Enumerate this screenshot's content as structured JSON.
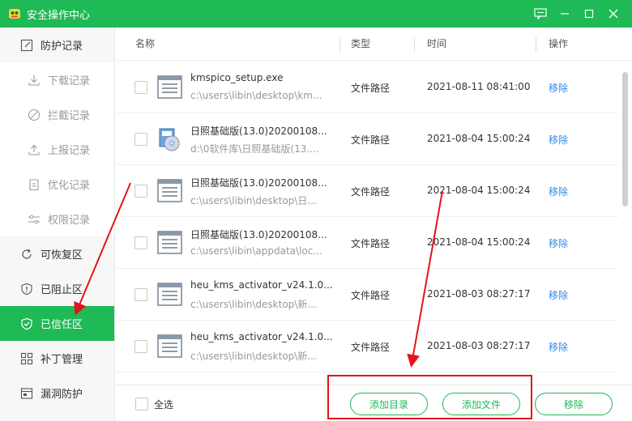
{
  "app": {
    "title": "安全操作中心"
  },
  "sidebar": {
    "items": [
      {
        "label": "防护记录",
        "icon": "edit-icon",
        "sub": false
      },
      {
        "label": "下载记录",
        "icon": "download-icon",
        "sub": true
      },
      {
        "label": "拦截记录",
        "icon": "block-icon",
        "sub": true
      },
      {
        "label": "上报记录",
        "icon": "upload-icon",
        "sub": true
      },
      {
        "label": "优化记录",
        "icon": "clipboard-icon",
        "sub": true
      },
      {
        "label": "权限记录",
        "icon": "sliders-icon",
        "sub": true
      },
      {
        "label": "可恢复区",
        "icon": "restore-icon",
        "sub": false
      },
      {
        "label": "已阻止区",
        "icon": "shield-alert-icon",
        "sub": false
      },
      {
        "label": "已信任区",
        "icon": "shield-check-icon",
        "sub": false,
        "active": true
      },
      {
        "label": "补丁管理",
        "icon": "grid-icon",
        "sub": false
      },
      {
        "label": "漏洞防护",
        "icon": "folder-shield-icon",
        "sub": false
      }
    ]
  },
  "table": {
    "headers": {
      "name": "名称",
      "type": "类型",
      "time": "时间",
      "action": "操作"
    },
    "rows": [
      {
        "name": "kmspico_setup.exe",
        "path": "c:\\users\\libin\\desktop\\km...",
        "type": "文件路径",
        "time": "2021-08-11 08:41:00",
        "action": "移除",
        "icon": "file-window-icon"
      },
      {
        "name": "日照基础版(13.0)20200108...",
        "path": "d:\\0软件库\\日照基础版(13....",
        "type": "文件路径",
        "time": "2021-08-04 15:00:24",
        "action": "移除",
        "icon": "installer-disc-icon"
      },
      {
        "name": "日照基础版(13.0)20200108...",
        "path": "c:\\users\\libin\\desktop\\日...",
        "type": "文件路径",
        "time": "2021-08-04 15:00:24",
        "action": "移除",
        "icon": "file-window-icon"
      },
      {
        "name": "日照基础版(13.0)20200108...",
        "path": "c:\\users\\libin\\appdata\\loc...",
        "type": "文件路径",
        "time": "2021-08-04 15:00:24",
        "action": "移除",
        "icon": "file-window-icon"
      },
      {
        "name": "heu_kms_activator_v24.1.0...",
        "path": "c:\\users\\libin\\desktop\\新...",
        "type": "文件路径",
        "time": "2021-08-03 08:27:17",
        "action": "移除",
        "icon": "file-window-icon"
      },
      {
        "name": "heu_kms_activator_v24.1.0...",
        "path": "c:\\users\\libin\\desktop\\新...",
        "type": "文件路径",
        "time": "2021-08-03 08:27:17",
        "action": "移除",
        "icon": "file-window-icon"
      }
    ]
  },
  "footer": {
    "select_all": "全选",
    "add_dir": "添加目录",
    "add_file": "添加文件",
    "remove": "移除"
  },
  "colors": {
    "accent": "#1fb956",
    "link": "#2c8ae8",
    "annotation": "#e3141a"
  }
}
